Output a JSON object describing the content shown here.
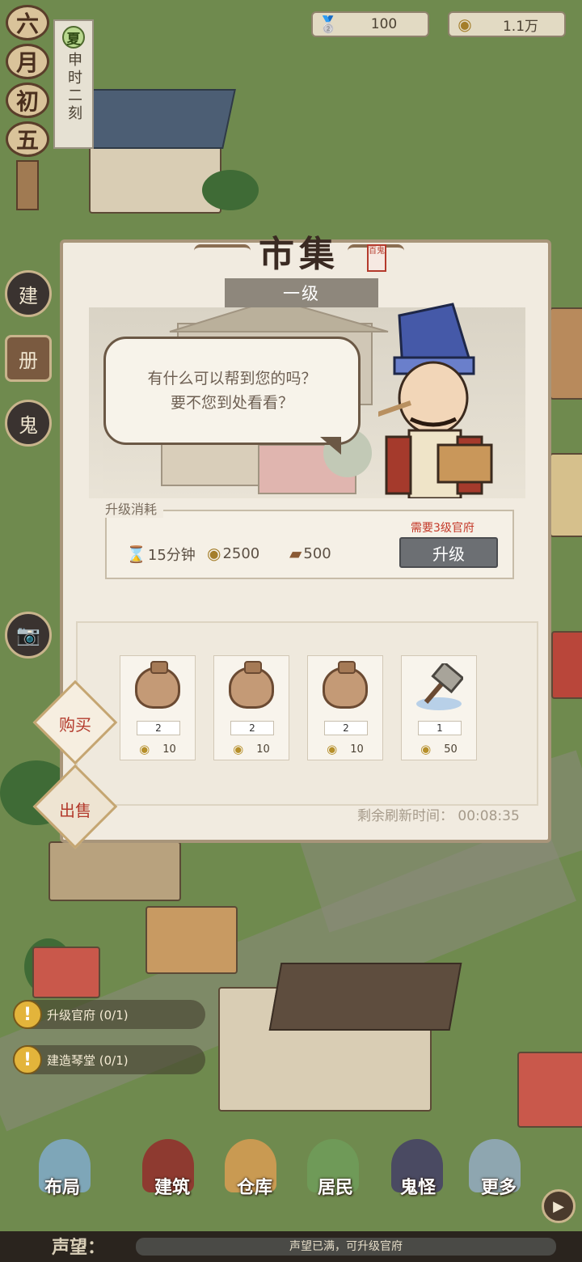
{
  "currency": [
    {
      "icon": "silver-ingot-icon",
      "value": "100"
    },
    {
      "icon": "copper-coin-icon",
      "value": "1.1万"
    }
  ],
  "calendar": {
    "date_chars": [
      "六",
      "月",
      "初",
      "五"
    ],
    "season": "夏",
    "time": "申时二刻"
  },
  "side_buttons": [
    {
      "name": "build-button",
      "label": "建"
    },
    {
      "name": "books-button",
      "label": "册"
    },
    {
      "name": "ghost-button",
      "label": "鬼"
    },
    {
      "name": "camera-button",
      "label": "📷"
    }
  ],
  "panel": {
    "title": "市集",
    "seal": "百鬼",
    "level": "一级",
    "speech": [
      "有什么可以帮到您的吗？",
      "要不您到处看看？"
    ],
    "upgrade_cost_label": "升级消耗",
    "costs": [
      {
        "icon": "hourglass-icon",
        "value": "15分钟"
      },
      {
        "icon": "coin-icon",
        "value": "2500"
      },
      {
        "icon": "wood-icon",
        "value": "500"
      }
    ],
    "requirement": "需要3级官府",
    "upgrade_button": "升级",
    "tabs": {
      "buy": "购买",
      "sell": "出售"
    },
    "items": [
      {
        "name": "seed-bag-wheat",
        "qty": "2",
        "price": "10"
      },
      {
        "name": "seed-bag-flower",
        "qty": "2",
        "price": "10"
      },
      {
        "name": "seed-bag-herb",
        "qty": "2",
        "price": "10"
      },
      {
        "name": "hammer",
        "qty": "1",
        "price": "50"
      }
    ],
    "refresh_text": "剩余刷新时间： 00:08:35"
  },
  "quests": [
    {
      "label": "升级官府 (0/1)"
    },
    {
      "label": "建造琴堂 (0/1)"
    }
  ],
  "nav": [
    "布局",
    "建筑",
    "仓库",
    "居民",
    "鬼怪",
    "更多"
  ],
  "reputation": {
    "label": "声望：",
    "status": "声望已满，可升级官府"
  }
}
